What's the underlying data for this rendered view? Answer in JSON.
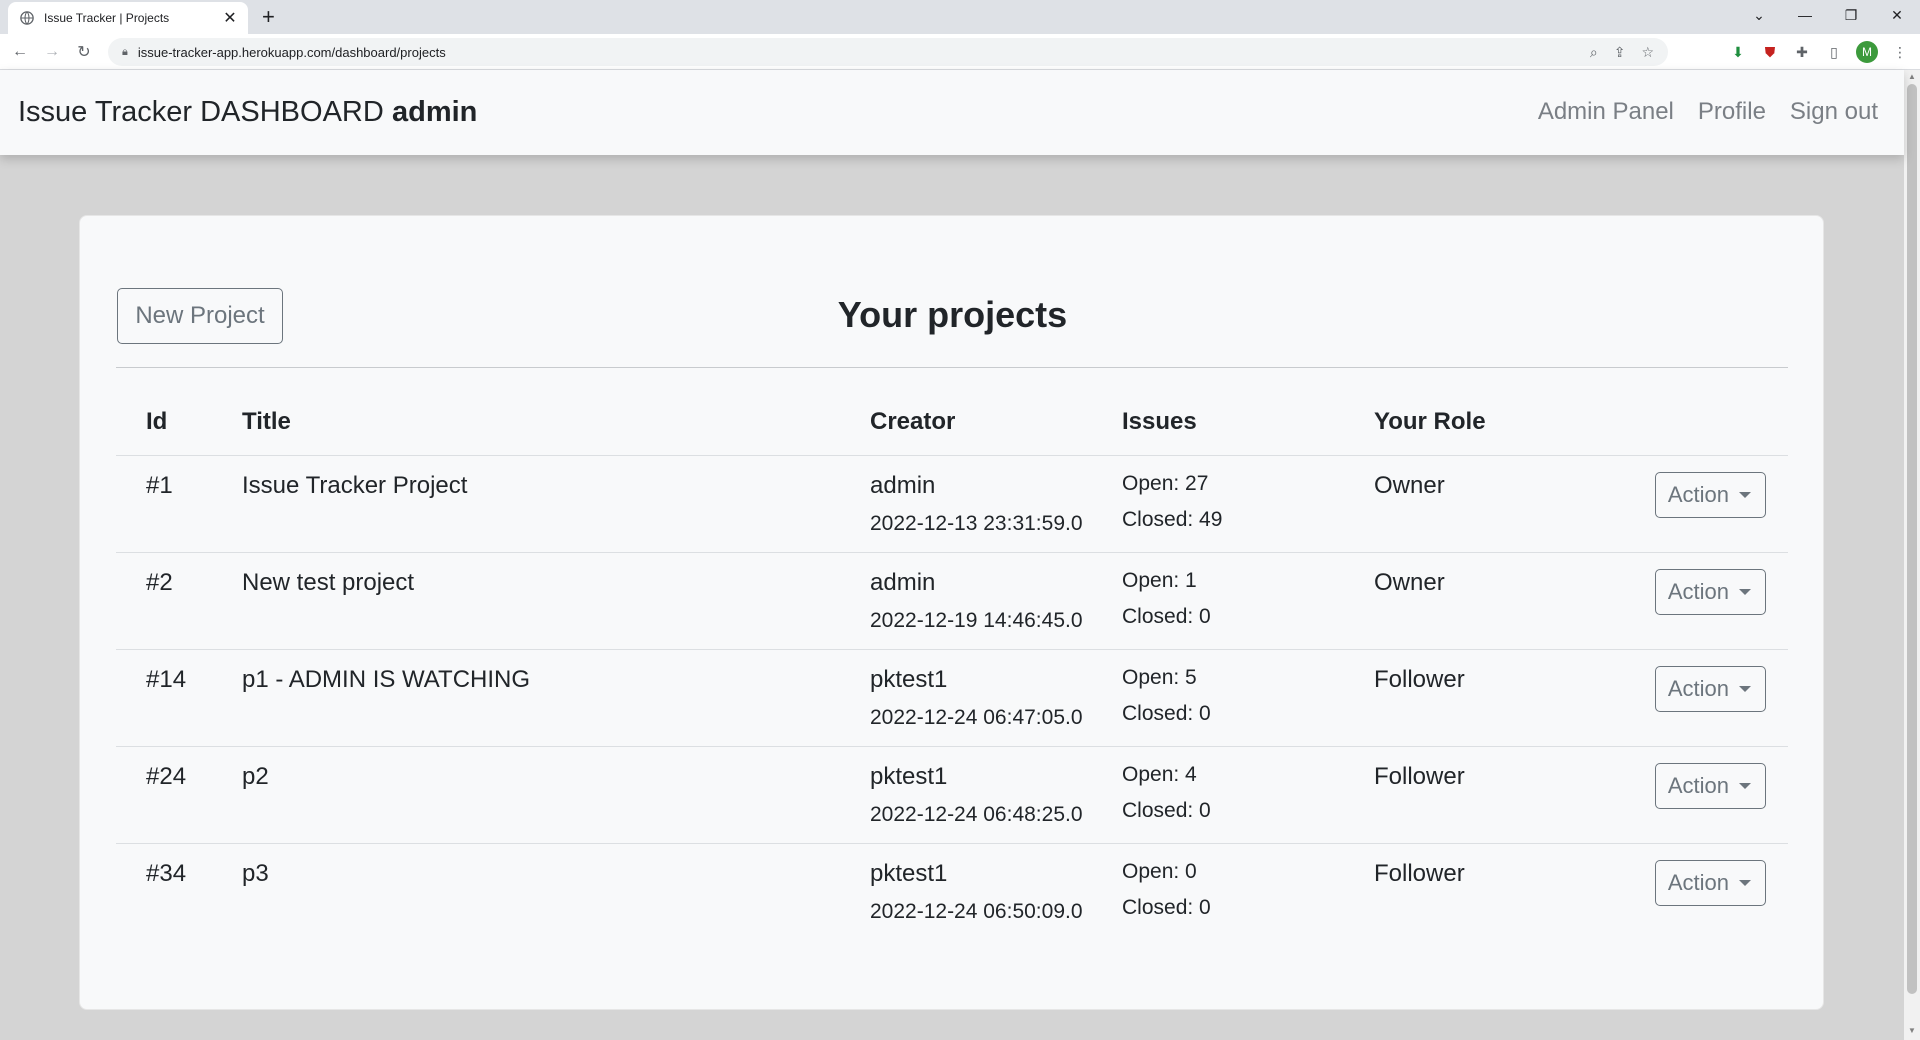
{
  "browser": {
    "tab_title": "Issue Tracker | Projects",
    "url": "issue-tracker-app.herokuapp.com/dashboard/projects",
    "profile_initial": "M"
  },
  "navbar": {
    "brand": "Issue Tracker DASHBOARD",
    "username": "admin",
    "links": [
      "Admin Panel",
      "Profile",
      "Sign out"
    ]
  },
  "main": {
    "new_project_label": "New Project",
    "heading": "Your projects",
    "columns": [
      "Id",
      "Title",
      "Creator",
      "Issues",
      "Your Role"
    ],
    "projects": [
      {
        "id": "#1",
        "title": "Issue Tracker Project",
        "creator": "admin",
        "created": "2022-12-13 23:31:59.0",
        "open": "Open: 27",
        "closed": "Closed: 49",
        "role": "Owner",
        "action": "Action"
      },
      {
        "id": "#2",
        "title": "New test project",
        "creator": "admin",
        "created": "2022-12-19 14:46:45.0",
        "open": "Open: 1",
        "closed": "Closed: 0",
        "role": "Owner",
        "action": "Action"
      },
      {
        "id": "#14",
        "title": "p1 - ADMIN IS WATCHING",
        "creator": "pktest1",
        "created": "2022-12-24 06:47:05.0",
        "open": "Open: 5",
        "closed": "Closed: 0",
        "role": "Follower",
        "action": "Action"
      },
      {
        "id": "#24",
        "title": "p2",
        "creator": "pktest1",
        "created": "2022-12-24 06:48:25.0",
        "open": "Open: 4",
        "closed": "Closed: 0",
        "role": "Follower",
        "action": "Action"
      },
      {
        "id": "#34",
        "title": "p3",
        "creator": "pktest1",
        "created": "2022-12-24 06:50:09.0",
        "open": "Open: 0",
        "closed": "Closed: 0",
        "role": "Follower",
        "action": "Action"
      }
    ]
  }
}
